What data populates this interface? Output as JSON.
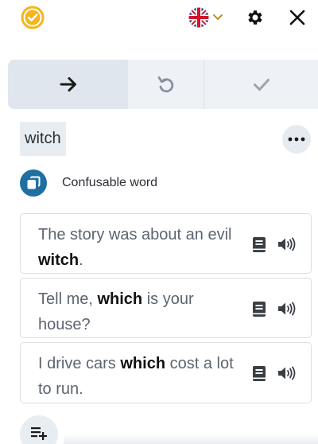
{
  "header": {
    "logo_icon": "check-circle-logo-icon",
    "language_flag_icon": "uk-flag-icon",
    "language_chevron_icon": "chevron-down-icon",
    "settings_icon": "gear-icon",
    "close_icon": "close-icon"
  },
  "toolbar": {
    "segments": [
      {
        "icon": "arrow-right-icon",
        "active": true
      },
      {
        "icon": "undo-icon",
        "active": false
      },
      {
        "icon": "check-icon",
        "active": false
      }
    ]
  },
  "word": {
    "text": "witch",
    "more_icon": "more-horizontal-icon"
  },
  "tag": {
    "icon": "copy-icon",
    "label": "Confusable word"
  },
  "sentences": [
    {
      "before": "The story was about an evil ",
      "bold": "witch",
      "after": "."
    },
    {
      "before": "Tell me, ",
      "bold": "which",
      "after": " is your house?"
    },
    {
      "before": "I drive cars ",
      "bold": "which",
      "after": " cost a lot to run."
    }
  ],
  "add_icon": "add-list-icon",
  "colors": {
    "accent": "#1f6fa3",
    "logo": "#f5b51b",
    "flag_chevron": "#b8860b"
  }
}
